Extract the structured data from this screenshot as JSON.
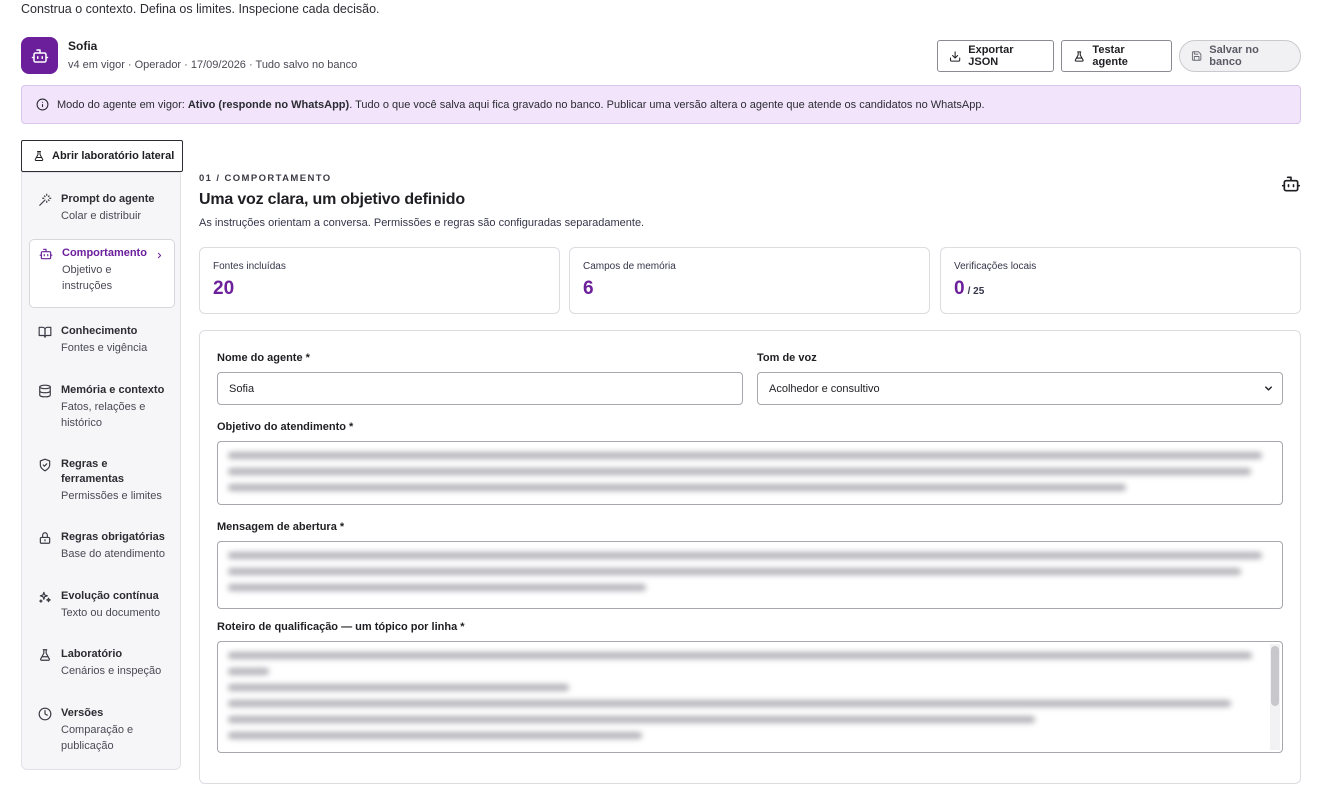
{
  "header": {
    "tagline": "Construa o contexto. Defina os limites. Inspecione cada decisão.",
    "agent_name": "Sofia",
    "agent_meta": "v4 em vigor · Operador · 17/09/2026 · Tudo salvo no banco",
    "export_label": "Exportar JSON",
    "test_label": "Testar agente",
    "save_label": "Salvar no banco"
  },
  "banner": {
    "prefix": "Modo do agente em vigor: ",
    "mode": "Ativo (responde no WhatsApp)",
    "suffix": ". Tudo o que você salva aqui fica gravado no banco. Publicar uma versão altera o agente que atende os candidatos no WhatsApp."
  },
  "lab_toggle_label": "Abrir laboratório lateral",
  "sidebar": {
    "items": [
      {
        "title": "Prompt do agente",
        "sub": "Colar e distribuir",
        "icon": "wand-icon"
      },
      {
        "title": "Comportamento",
        "sub": "Objetivo e instruções",
        "icon": "bot-icon",
        "active": true
      },
      {
        "title": "Conhecimento",
        "sub": "Fontes e vigência",
        "icon": "book-icon"
      },
      {
        "title": "Memória e contexto",
        "sub": "Fatos, relações e histórico",
        "icon": "database-icon"
      },
      {
        "title": "Regras e ferramentas",
        "sub": "Permissões e limites",
        "icon": "shield-icon"
      },
      {
        "title": "Regras obrigatórias",
        "sub": "Base do atendimento",
        "icon": "lock-icon"
      },
      {
        "title": "Evolução contínua",
        "sub": "Texto ou documento",
        "icon": "sparkles-icon"
      },
      {
        "title": "Laboratório",
        "sub": "Cenários e inspeção",
        "icon": "flask-icon"
      },
      {
        "title": "Versões",
        "sub": "Comparação e publicação",
        "icon": "clock-icon"
      }
    ]
  },
  "section": {
    "kicker": "01 / COMPORTAMENTO",
    "title": "Uma voz clara, um objetivo definido",
    "description": "As instruções orientam a conversa. Permissões e regras são configuradas separadamente."
  },
  "stats": [
    {
      "label": "Fontes incluídas",
      "value": "20",
      "suffix": ""
    },
    {
      "label": "Campos de memória",
      "value": "6",
      "suffix": ""
    },
    {
      "label": "Verificações locais",
      "value": "0",
      "suffix": "/ 25"
    }
  ],
  "form": {
    "name_label": "Nome do agente *",
    "name_value": "Sofia",
    "tone_label": "Tom de voz",
    "tone_value": "Acolhedor e consultivo",
    "goal_label": "Objetivo do atendimento *",
    "opening_label": "Mensagem de abertura *",
    "script_label": "Roteiro de qualificação — um tópico por linha *"
  }
}
